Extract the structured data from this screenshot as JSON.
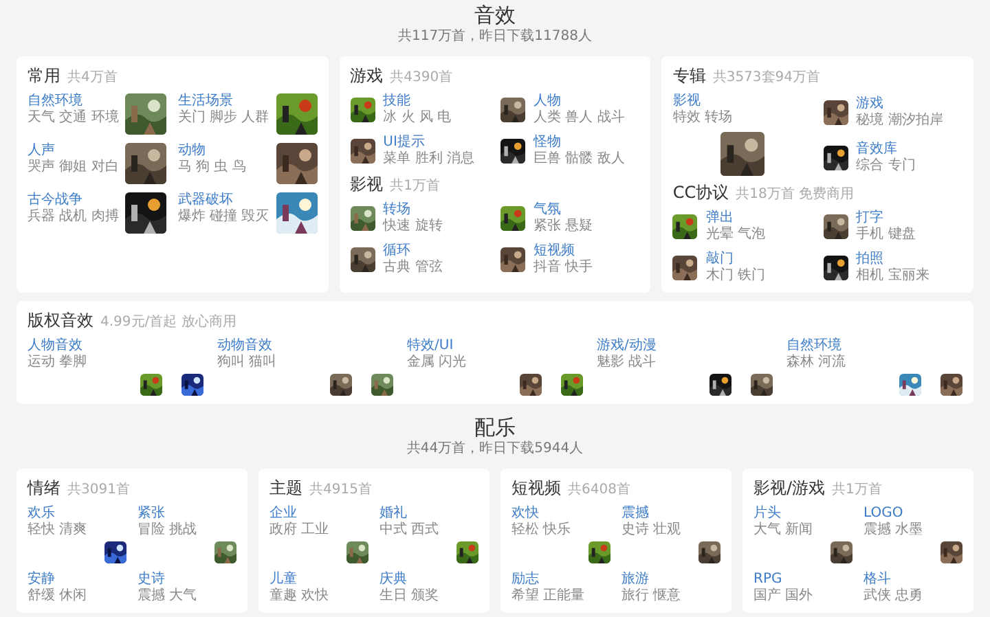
{
  "sections": [
    {
      "title": "音效",
      "subtitle": "共117万首，昨日下载11788人",
      "rows": [
        [
          {
            "groups": [
              {
                "title": "常用",
                "count": "共4万首",
                "kind": "pair",
                "items": [
                  {
                    "kind": "tile",
                    "label": "自然环境",
                    "sub": "天气 交通 环境"
                  },
                  {
                    "kind": "tile",
                    "label": "生活场景",
                    "sub": "关门 脚步 人群"
                  },
                  {
                    "kind": "tile",
                    "label": "人声",
                    "sub": "哭声 御姐 对白"
                  },
                  {
                    "kind": "tile",
                    "label": "动物",
                    "sub": "马 狗 虫 鸟"
                  },
                  {
                    "kind": "tile",
                    "label": "古今战争",
                    "sub": "兵器 战机 肉搏"
                  },
                  {
                    "kind": "tile",
                    "label": "武器破坏",
                    "sub": "爆炸 碰撞 毁灭"
                  }
                ]
              }
            ]
          },
          {
            "groups": [
              {
                "title": "游戏",
                "count": "共4390首",
                "kind": "pair",
                "items": [
                  {
                    "kind": "icon",
                    "label": "技能",
                    "sub": "冰 火 风 电"
                  },
                  {
                    "kind": "icon",
                    "label": "人物",
                    "sub": "人类 兽人 战斗"
                  },
                  {
                    "kind": "icon",
                    "label": "UI提示",
                    "sub": "菜单 胜利 消息"
                  },
                  {
                    "kind": "icon",
                    "label": "怪物",
                    "sub": "巨兽 骷髅 敌人"
                  }
                ]
              },
              {
                "title": "影视",
                "count": "共1万首",
                "kind": "pair",
                "items": [
                  {
                    "kind": "icon",
                    "label": "转场",
                    "sub": "快速 旋转"
                  },
                  {
                    "kind": "icon",
                    "label": "气氛",
                    "sub": "紧张 悬疑"
                  },
                  {
                    "kind": "icon",
                    "label": "循环",
                    "sub": "古典 管弦"
                  },
                  {
                    "kind": "icon",
                    "label": "短视频",
                    "sub": "抖音 快手"
                  }
                ]
              }
            ]
          },
          {
            "groups": [
              {
                "title": "专辑",
                "count": "共3573套94万首",
                "kind": "pair",
                "items": [
                  {
                    "kind": "feature",
                    "label": "影视",
                    "sub": "特效 转场"
                  },
                  {
                    "kind": "icon",
                    "label": "游戏",
                    "sub": "秘境 潮汐拍岸"
                  },
                  {
                    "kind": "icon",
                    "label": "音效库",
                    "sub": "综合 专门"
                  }
                ]
              },
              {
                "title": "CC协议",
                "count": "共18万首 免费商用",
                "kind": "pair",
                "items": [
                  {
                    "kind": "icon",
                    "label": "弹出",
                    "sub": "光晕 气泡"
                  },
                  {
                    "kind": "icon",
                    "label": "打字",
                    "sub": "手机 键盘"
                  },
                  {
                    "kind": "icon",
                    "label": "敲门",
                    "sub": "木门 铁门"
                  },
                  {
                    "kind": "icon",
                    "label": "拍照",
                    "sub": "相机 宝丽来"
                  }
                ]
              }
            ]
          }
        ],
        [
          {
            "groups": [
              {
                "title": "版权音效",
                "count": "4.99元/首起 放心商用",
                "kind": "row",
                "items": [
                  {
                    "kind": "strip",
                    "label": "人物音效",
                    "sub": "运动 拳脚"
                  },
                  {
                    "kind": "strip",
                    "label": "动物音效",
                    "sub": "狗叫 猫叫"
                  },
                  {
                    "kind": "strip",
                    "label": "特效/UI",
                    "sub": "金属 闪光"
                  },
                  {
                    "kind": "strip",
                    "label": "游戏/动漫",
                    "sub": "魅影 战斗"
                  },
                  {
                    "kind": "strip",
                    "label": "自然环境",
                    "sub": "森林 河流"
                  }
                ]
              }
            ]
          }
        ]
      ]
    },
    {
      "title": "配乐",
      "subtitle": "共44万首，昨日下载5944人",
      "rows": [
        [
          {
            "groups": [
              {
                "title": "情绪",
                "count": "共3091首",
                "kind": "pair",
                "items": [
                  {
                    "kind": "stack",
                    "label": "欢乐",
                    "sub": "轻快 清爽"
                  },
                  {
                    "kind": "stack",
                    "label": "紧张",
                    "sub": "冒险 挑战"
                  },
                  {
                    "kind": "stack",
                    "label": "安静",
                    "sub": "舒缓 休闲"
                  },
                  {
                    "kind": "stack",
                    "label": "史诗",
                    "sub": "震撼 大气"
                  }
                ]
              }
            ]
          },
          {
            "groups": [
              {
                "title": "主题",
                "count": "共4915首",
                "kind": "pair",
                "items": [
                  {
                    "kind": "stack",
                    "label": "企业",
                    "sub": "政府 工业"
                  },
                  {
                    "kind": "stack",
                    "label": "婚礼",
                    "sub": "中式 西式"
                  },
                  {
                    "kind": "stack",
                    "label": "儿童",
                    "sub": "童趣 欢快"
                  },
                  {
                    "kind": "stack",
                    "label": "庆典",
                    "sub": "生日 颁奖"
                  }
                ]
              }
            ]
          },
          {
            "groups": [
              {
                "title": "短视频",
                "count": "共6408首",
                "kind": "pair",
                "items": [
                  {
                    "kind": "stack",
                    "label": "欢快",
                    "sub": "轻松 快乐"
                  },
                  {
                    "kind": "stack",
                    "label": "震撼",
                    "sub": "史诗 壮观"
                  },
                  {
                    "kind": "stack",
                    "label": "励志",
                    "sub": "希望 正能量"
                  },
                  {
                    "kind": "stack",
                    "label": "旅游",
                    "sub": "旅行 惬意"
                  }
                ]
              }
            ]
          },
          {
            "groups": [
              {
                "title": "影视/游戏",
                "count": "共1万首",
                "kind": "pair",
                "items": [
                  {
                    "kind": "stack",
                    "label": "片头",
                    "sub": "大气 新闻"
                  },
                  {
                    "kind": "stack",
                    "label": "LOGO",
                    "sub": "震撼 水墨"
                  },
                  {
                    "kind": "stack",
                    "label": "RPG",
                    "sub": "国产 国外"
                  },
                  {
                    "kind": "stack",
                    "label": "格斗",
                    "sub": "武侠 忠勇"
                  }
                ]
              }
            ]
          }
        ]
      ]
    }
  ]
}
